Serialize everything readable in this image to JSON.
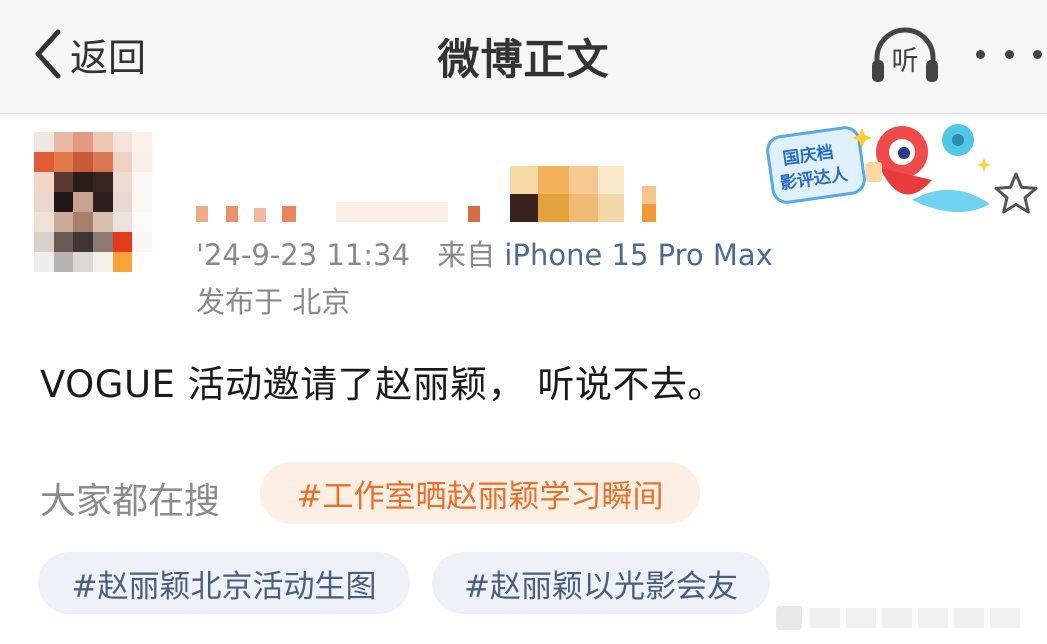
{
  "header": {
    "back_label": "返回",
    "title": "微博正文",
    "listen_label": "听",
    "icons": [
      "back-chevron-icon",
      "headphones-icon",
      "more-dots-icon"
    ]
  },
  "post": {
    "timestamp_source": "'24-9-23 11:34",
    "from_label": "来自",
    "device": "iPhone 15 Pro Max",
    "location": "发布于 北京",
    "text": "VOGUE 活动邀请了赵丽颖，  听说不去。",
    "nickname_hidden": "mosaic",
    "decoration_badge": "国庆档影评达人"
  },
  "trending": {
    "label": "大家都在搜",
    "tags": [
      "#工作室晒赵丽颖学习瞬间",
      "#赵丽颖北京活动生图",
      "#赵丽颖以光影会友"
    ]
  },
  "colors": {
    "hot_tag_bg": "#fdefe4",
    "hot_tag_text": "#e96f2a",
    "tag_bg": "#eef2f8",
    "tag_text": "#4a5f80",
    "source_link": "#4e6a91"
  }
}
